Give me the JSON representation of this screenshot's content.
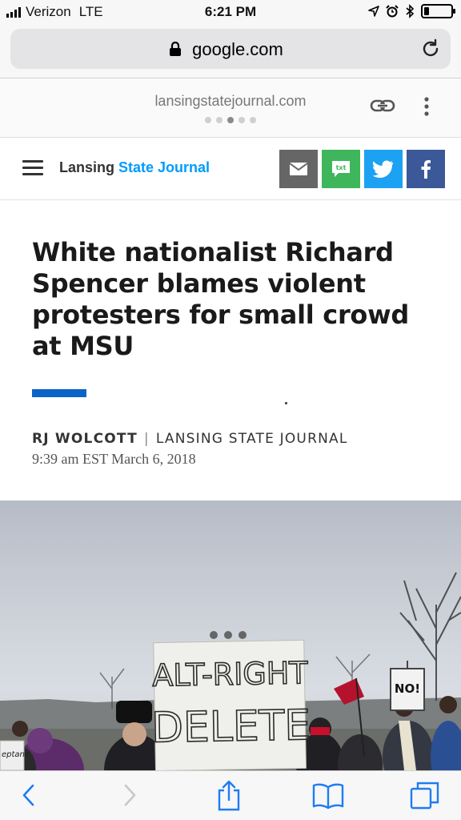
{
  "status_bar": {
    "carrier": "Verizon",
    "network": "LTE",
    "time": "6:21 PM",
    "battery_level": 0.2,
    "icons": [
      "signal-icon",
      "location-icon",
      "alarm-icon",
      "bluetooth-icon",
      "battery-icon"
    ]
  },
  "browser": {
    "url": "google.com",
    "icons": [
      "lock-icon",
      "reload-icon"
    ]
  },
  "amp_header": {
    "domain": "lansingstatejournal.com",
    "page_dots_total": 5,
    "page_dots_active_index": 2,
    "icons": [
      "link-icon",
      "more-icon"
    ]
  },
  "site": {
    "logo_part1": "Lansing",
    "logo_part2": "State Journal",
    "share_buttons": [
      "email",
      "sms",
      "twitter",
      "facebook"
    ],
    "share_sms_label": "txt",
    "colors": {
      "logo_accent": "#009bff",
      "email": "#666666",
      "sms": "#3fb65c",
      "twitter": "#1da1f2",
      "facebook": "#3b5998",
      "accent_bar": "#0a63c9"
    }
  },
  "article": {
    "headline": "White nationalist Richard Spencer blames violent protesters for small crowd at MSU",
    "author": "RJ WOLCOTT",
    "separator": "|",
    "publication": "LANSING STATE JOURNAL",
    "date": "9:39 am EST March 6, 2018"
  },
  "photo": {
    "sign_line1": "ALT-RIGHT",
    "sign_line2": "DELETE",
    "small_sign": "NO!",
    "left_sign": "eptans"
  },
  "toolbar": {
    "icons": [
      "back-icon",
      "forward-icon",
      "share-icon",
      "bookmarks-icon",
      "tabs-icon"
    ]
  }
}
